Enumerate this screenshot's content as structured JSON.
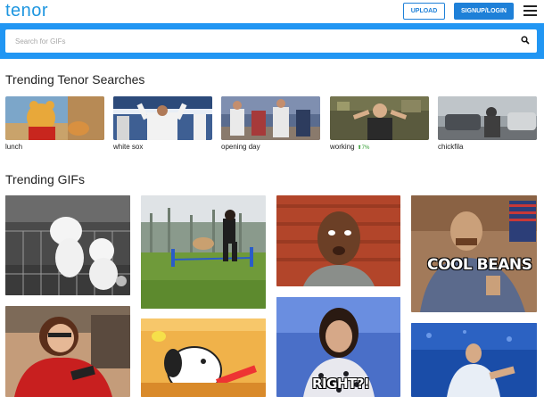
{
  "header": {
    "logo": "tenor",
    "upload_label": "UPLOAD",
    "signup_label": "SIGNUP/LOGIN"
  },
  "search": {
    "placeholder": "Search for GIFs"
  },
  "trending_searches": {
    "title": "Trending Tenor Searches",
    "items": [
      {
        "label": "lunch"
      },
      {
        "label": "white sox"
      },
      {
        "label": "opening day"
      },
      {
        "label": "working",
        "badge": "⬆7%"
      },
      {
        "label": "chickfila"
      }
    ]
  },
  "trending_gifs": {
    "title": "Trending GIFs",
    "captions": {
      "cool_beans": "COOL BEANS",
      "right": "RIGHT?!"
    }
  },
  "colors": {
    "brand": "#1e96e0",
    "search_bar": "#2196f3",
    "button": "#1e80d8",
    "trend_up": "#2e9b2e"
  },
  "icons": [
    "menu-icon",
    "search-icon"
  ]
}
